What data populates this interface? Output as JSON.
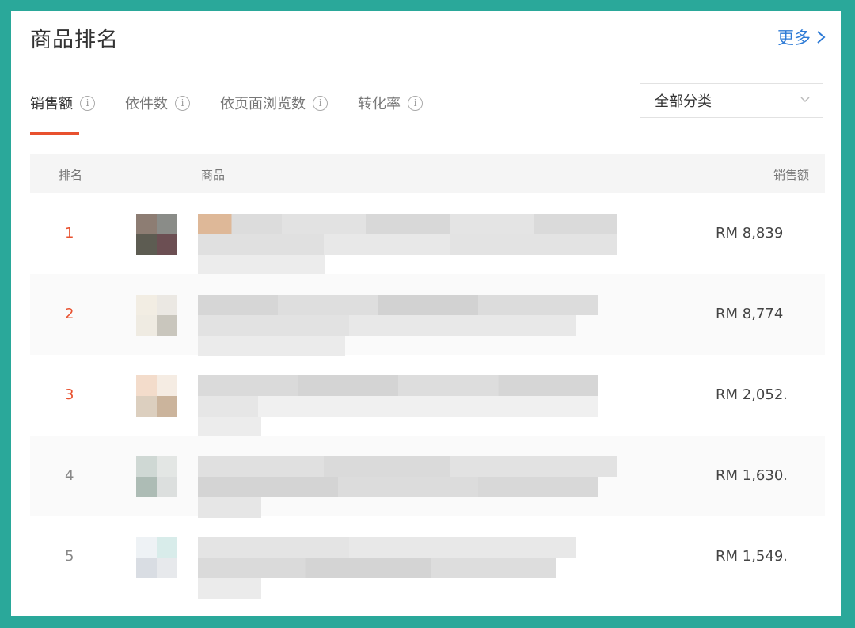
{
  "header": {
    "title": "商品排名",
    "more_label": "更多"
  },
  "tabs": [
    {
      "label": "销售额",
      "active": true
    },
    {
      "label": "依件数",
      "active": false
    },
    {
      "label": "依页面浏览数",
      "active": false
    },
    {
      "label": "转化率",
      "active": false
    }
  ],
  "category_select": {
    "value": "全部分类"
  },
  "table": {
    "columns": {
      "rank": "排名",
      "product": "商品",
      "sales": "销售额"
    },
    "rows": [
      {
        "rank": "1",
        "sales": "RM 8,839"
      },
      {
        "rank": "2",
        "sales": "RM 8,774"
      },
      {
        "rank": "3",
        "sales": "RM 2,052."
      },
      {
        "rank": "4",
        "sales": "RM 1,630."
      },
      {
        "rank": "5",
        "sales": "RM 1,549."
      }
    ]
  },
  "colors": {
    "accent": "#e8512f",
    "link": "#2e7bd6",
    "frame": "#2aa89a"
  },
  "icons": {
    "more": "chevron-right-icon",
    "info": "info-circle-icon",
    "select": "chevron-down-icon"
  }
}
